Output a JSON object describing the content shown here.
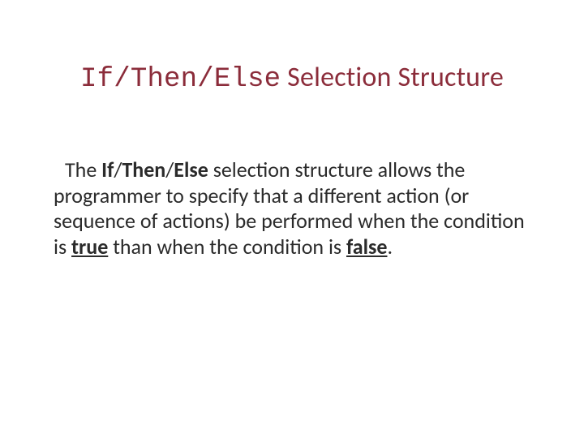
{
  "title": {
    "mono": "If/Then/Else",
    "rest": " Selection Structure"
  },
  "body": {
    "t0": "The ",
    "kw_if": "If",
    "sep1": "/",
    "kw_then": "Then",
    "sep2": "/",
    "kw_else": "Else",
    "t1": " selection structure allows the programmer to specify that a different action (or sequence of actions) be performed when the condition is ",
    "u_true": "true",
    "t2": " than when the condition is ",
    "u_false": "false",
    "t3": "."
  }
}
